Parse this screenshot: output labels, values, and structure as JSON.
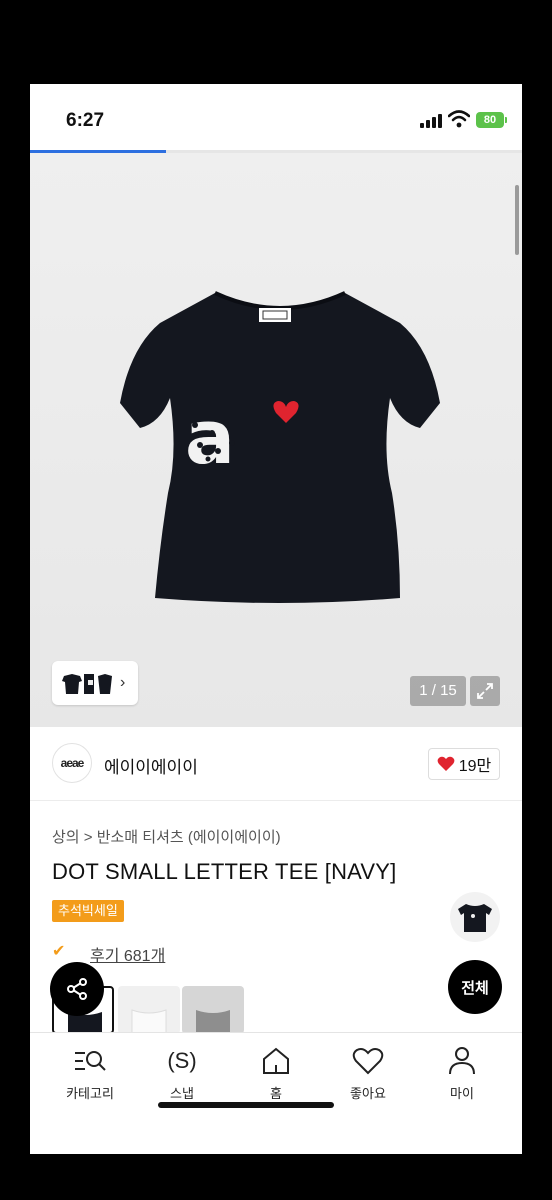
{
  "status_bar": {
    "time": "6:27",
    "battery": "80"
  },
  "image_viewer": {
    "counter": "1 / 15",
    "thumb_chevron": "›"
  },
  "brand": {
    "logo_text": "aeae",
    "name": "에이이에이이",
    "likes": "19만"
  },
  "product": {
    "breadcrumb": "상의 > 반소매 티셔츠 (에이이에이이)",
    "title": "DOT SMALL LETTER TEE [NAVY]",
    "sale_badge": "추석빅세일",
    "review_text": "후기 681개",
    "all_button": "전체"
  },
  "bottom_nav": {
    "items": [
      {
        "label": "카테고리",
        "icon": "category-search-icon"
      },
      {
        "label": "스냅",
        "icon": "snap-icon"
      },
      {
        "label": "홈",
        "icon": "home-icon"
      },
      {
        "label": "좋아요",
        "icon": "heart-outline-icon"
      },
      {
        "label": "마이",
        "icon": "person-icon"
      }
    ]
  },
  "colors": {
    "accent_blue": "#2d6fe0",
    "sale_orange": "#f39c1a",
    "heart_red": "#e0242f",
    "tee_navy": "#14171f"
  }
}
